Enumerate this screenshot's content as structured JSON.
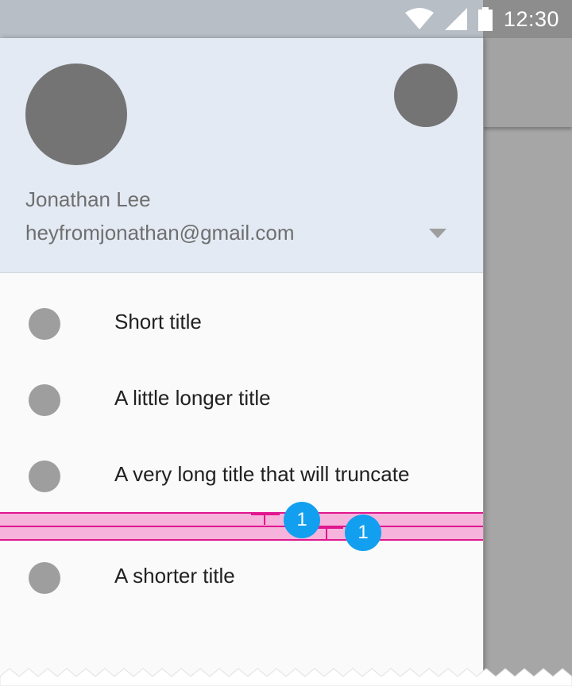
{
  "status_bar": {
    "time": "12:30",
    "icons": [
      "wifi-icon",
      "cellular-signal-icon",
      "battery-icon"
    ]
  },
  "drawer": {
    "header": {
      "account_name": "Jonathan Lee",
      "account_email": "heyfromjonathan@gmail.com",
      "dropdown_icon": "arrow-drop-down-icon"
    },
    "items": [
      {
        "label": "Short title"
      },
      {
        "label": "A little longer title"
      },
      {
        "label": "A very long title that will truncate"
      },
      {
        "label": "A shorter title"
      }
    ]
  },
  "spec": {
    "badge_1": "1",
    "badge_2": "1",
    "band_color": "#f6b4dc",
    "line_color": "#e0178f",
    "badge_color": "#139ff0"
  },
  "colors": {
    "status_bar": "#b7bec6",
    "header_bg": "#e3eaf4",
    "drawer_bg": "#fafafa",
    "avatar": "#747474",
    "item_icon": "#9e9e9e"
  }
}
